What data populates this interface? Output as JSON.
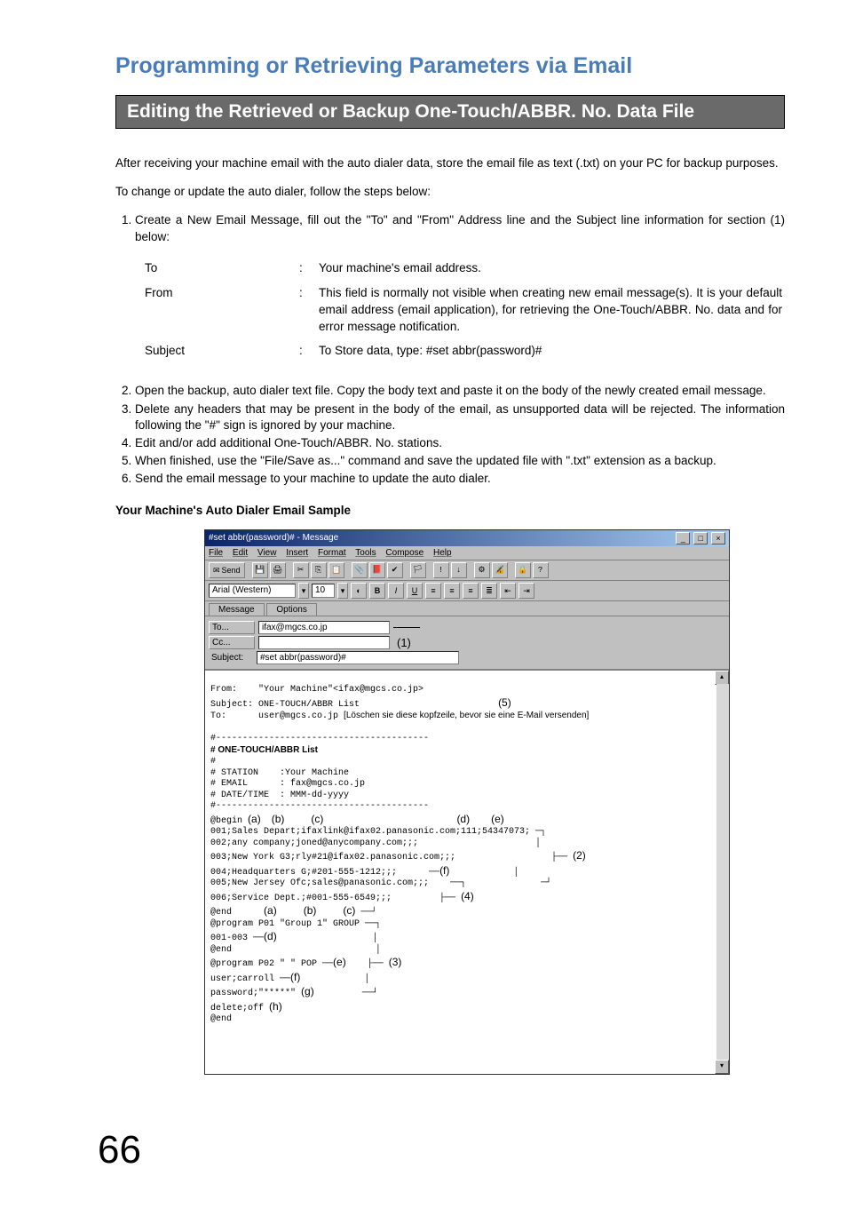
{
  "main_title": "Programming or Retrieving Parameters via Email",
  "section_title": "Editing the Retrieved or Backup One-Touch/ABBR. No. Data File",
  "intro_p1": "After receiving your machine email with the auto dialer data, store the email file as text (.txt) on your PC for backup purposes.",
  "intro_p2": "To change or update the auto dialer, follow the steps below:",
  "step1": "Create a New Email Message, fill out the \"To\" and \"From\" Address line and the Subject line information for section (1) below:",
  "fields": {
    "to_label": "To",
    "to_desc": "Your machine's email address.",
    "from_label": "From",
    "from_desc": "This field is normally not visible when creating new email message(s). It is your default email address (email application), for retrieving the One-Touch/ABBR. No. data and for error message notification.",
    "subject_label": "Subject",
    "subject_desc": "To Store data, type: #set abbr(password)#",
    "colon": ":"
  },
  "step2": "Open the backup, auto dialer text file.  Copy the body text and paste it on the body of the newly created email message.",
  "step3": "Delete any headers that may be present in the body of the email, as unsupported data will be rejected. The information following the \"#\" sign is ignored by your machine.",
  "step4": "Edit and/or add additional One-Touch/ABBR. No. stations.",
  "step5": "When finished, use the \"File/Save as...\" command and save the updated file with \".txt\" extension as a backup.",
  "step6": "Send the email message to your machine to update the auto dialer.",
  "sample_label": "Your Machine's Auto Dialer Email Sample",
  "win": {
    "title": "#set abbr(password)# - Message",
    "menu": {
      "file": "File",
      "edit": "Edit",
      "view": "View",
      "insert": "Insert",
      "format": "Format",
      "tools": "Tools",
      "compose": "Compose",
      "help": "Help"
    },
    "tb": {
      "send": "Send"
    },
    "fmt": {
      "font": "Arial (Western)",
      "size": "10",
      "b": "B",
      "i": "I",
      "u": "U"
    },
    "tabs": {
      "message": "Message",
      "options": "Options"
    },
    "addr": {
      "to": "To...",
      "to_val": "ifax@mgcs.co.jp",
      "cc": "Cc...",
      "subject": "Subject:",
      "subject_val": "#set abbr(password)#"
    },
    "body": {
      "from": "From:    \"Your Machine\"<ifax@mgcs.co.jp>",
      "subject": "Subject: ONE-TOUCH/ABBR List",
      "to": "To:      user@mgcs.co.jp",
      "hint": "[Löschen sie diese kopfzeile, bevor sie eine E-Mail versenden]",
      "h_rule": "#----------------------------------------",
      "h_list": "# ONE-TOUCH/ABBR List",
      "h_hash": "#",
      "h_station": "# STATION    :Your Machine",
      "h_email": "# EMAIL      : fax@mgcs.co.jp",
      "h_date": "# DATE/TIME  : MMM-dd-yyyy",
      "begin": "@begin",
      "l1": "001;Sales Depart;ifaxlink@ifax02.panasonic.com;111;54347073;",
      "l2": "002;any company;joned@anycompany.com;;;",
      "l3": "003;New York G3;rly#21@ifax02.panasonic.com;;;",
      "l4": "004;Headquarters G;#201-555-1212;;;",
      "l5": "005;New Jersey Ofc;sales@panasonic.com;;;",
      "l6": "006;Service Dept.;#001-555-6549;;;",
      "end": "@end",
      "prog1": "@program P01 \"Group 1\" GROUP",
      "prog1b": "001-003",
      "prog2": "@program P02 \" \" POP",
      "userline": "user;carroll",
      "passline": "password;\"*****\"",
      "delline": "delete;off"
    },
    "callouts": {
      "c1": "(1)",
      "c2": "(2)",
      "c3": "(3)",
      "c4": "(4)",
      "c5": "(5)",
      "a": "(a)",
      "b": "(b)",
      "c": "(c)",
      "d": "(d)",
      "e": "(e)",
      "f": "(f)",
      "g": "(g)",
      "h": "(h)"
    }
  },
  "page_number": "66"
}
